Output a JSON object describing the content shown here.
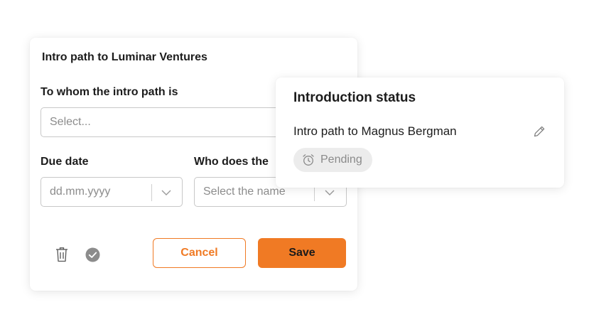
{
  "form": {
    "title": "Intro path to Luminar Ventures",
    "whom_label": "To whom the intro path is",
    "whom_placeholder": "Select...",
    "due_label": "Due date",
    "due_placeholder": "dd.mm.yyyy",
    "who_label": "Who does the",
    "who_placeholder": "Select the name",
    "cancel_label": "Cancel",
    "save_label": "Save"
  },
  "status": {
    "title": "Introduction status",
    "intro_text": "Intro path to Magnus Bergman",
    "badge_label": "Pending"
  },
  "colors": {
    "accent": "#f07a24",
    "badge_bg": "#ececec"
  },
  "icons": [
    "chevron-down-icon",
    "trash-icon",
    "check-circle-icon",
    "pencil-icon",
    "alarm-clock-icon"
  ]
}
